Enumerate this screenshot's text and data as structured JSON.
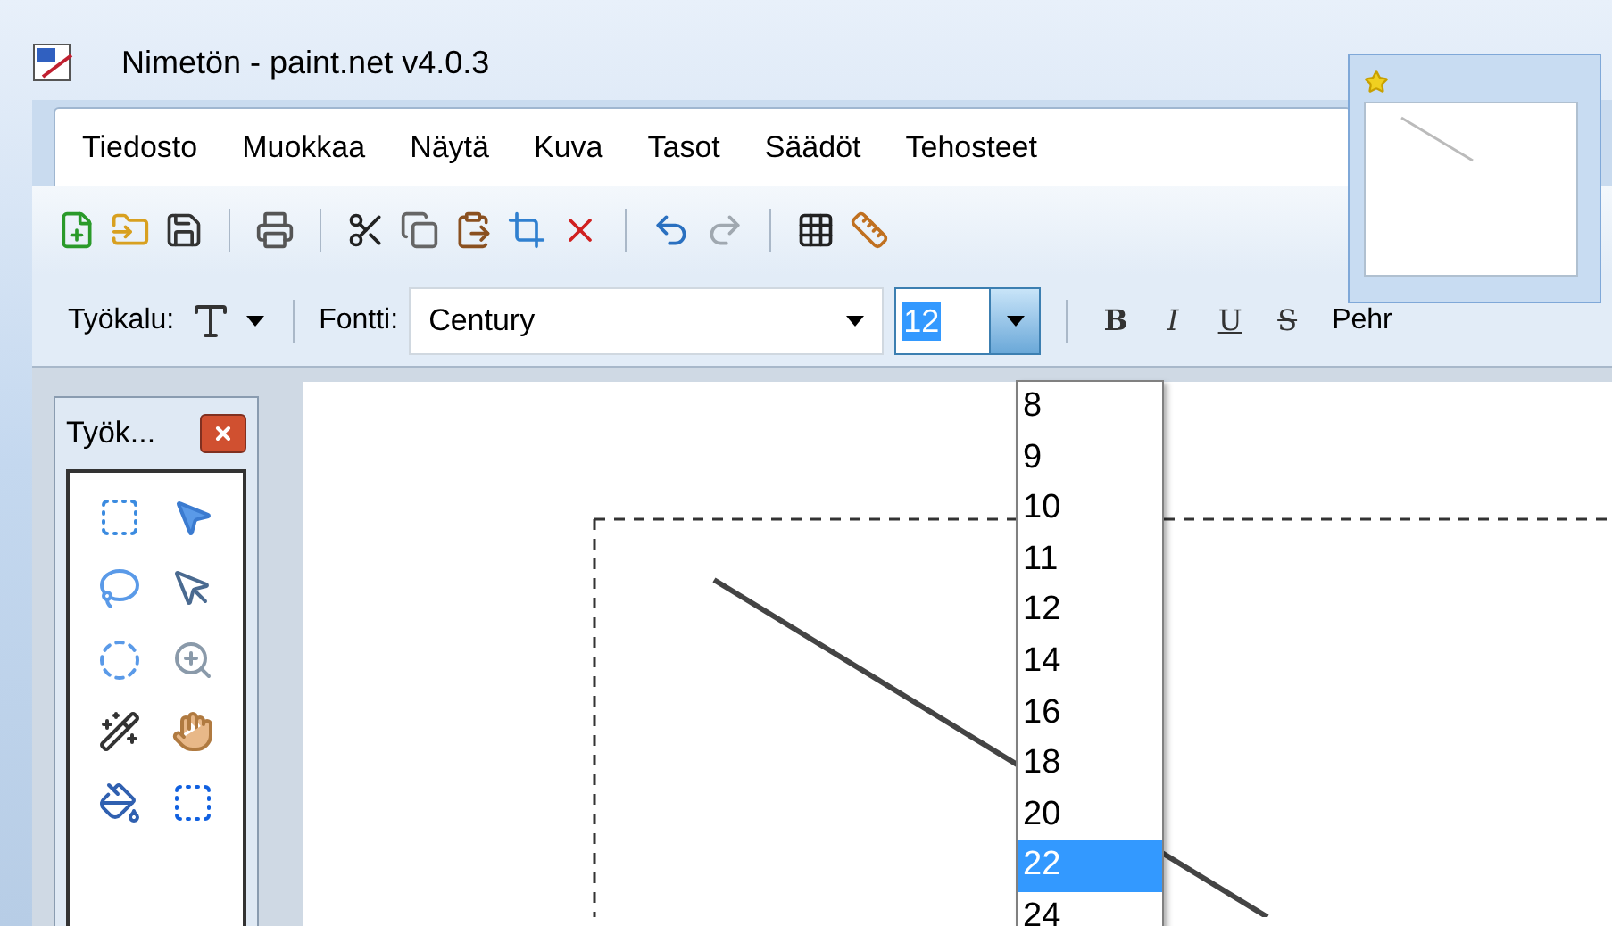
{
  "window": {
    "title": "Nimetön - paint.net v4.0.3"
  },
  "menu": [
    {
      "label": "Tiedosto"
    },
    {
      "label": "Muokkaa"
    },
    {
      "label": "Näytä"
    },
    {
      "label": "Kuva"
    },
    {
      "label": "Tasot"
    },
    {
      "label": "Säädöt"
    },
    {
      "label": "Tehosteet"
    }
  ],
  "text_toolbar": {
    "tool_label": "Työkalu:",
    "font_label": "Fontti:",
    "font": "Century",
    "size": "12",
    "style_buttons": [
      {
        "kind": "bold",
        "label": "B"
      },
      {
        "kind": "italic",
        "label": "I"
      },
      {
        "kind": "underline",
        "label": "U"
      },
      {
        "kind": "strike",
        "label": "S"
      }
    ],
    "cut_label": "Pehr"
  },
  "size_dropdown": {
    "items": [
      {
        "label": "8",
        "selected": false
      },
      {
        "label": "9",
        "selected": false
      },
      {
        "label": "10",
        "selected": false
      },
      {
        "label": "11",
        "selected": false
      },
      {
        "label": "12",
        "selected": false
      },
      {
        "label": "14",
        "selected": false
      },
      {
        "label": "16",
        "selected": false
      },
      {
        "label": "18",
        "selected": false
      },
      {
        "label": "20",
        "selected": false
      },
      {
        "label": "22",
        "selected": true
      },
      {
        "label": "24",
        "selected": false
      }
    ]
  },
  "tools_panel": {
    "title": "Työk..."
  }
}
